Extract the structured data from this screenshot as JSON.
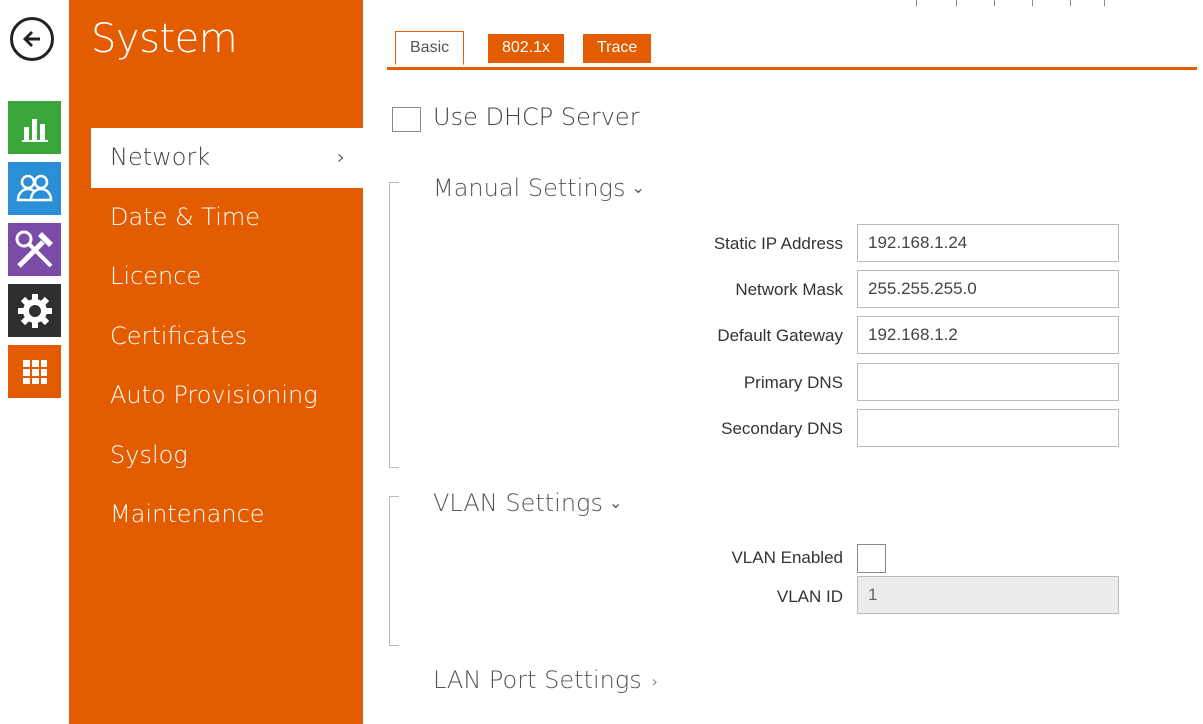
{
  "sidebar": {
    "title": "System",
    "items": [
      {
        "label": "Network",
        "active": true
      },
      {
        "label": "Date & Time"
      },
      {
        "label": "Licence"
      },
      {
        "label": "Certificates"
      },
      {
        "label": "Auto Provisioning"
      },
      {
        "label": "Syslog"
      },
      {
        "label": "Maintenance"
      }
    ],
    "active_chevron": "›"
  },
  "rail": {
    "icons": [
      "back-arrow-icon",
      "status-chart-icon",
      "directory-users-icon",
      "hardware-tools-icon",
      "system-gear-icon",
      "services-grid-icon"
    ],
    "colors": {
      "status": "#3aa53a",
      "directory": "#2a8fd6",
      "hardware": "#7b4ba8",
      "system": "#2f2f2f",
      "services": "#e25b00"
    }
  },
  "tabs": [
    {
      "label": "Basic",
      "active": true
    },
    {
      "label": "802.1x"
    },
    {
      "label": "Trace"
    }
  ],
  "dhcp": {
    "label": "Use DHCP Server",
    "checked": false
  },
  "manual": {
    "title": "Manual Settings",
    "caret": "⌄",
    "static_ip_label": "Static IP Address",
    "static_ip_value": "192.168.1.24",
    "mask_label": "Network Mask",
    "mask_value": "255.255.255.0",
    "gateway_label": "Default Gateway",
    "gateway_value": "192.168.1.2",
    "dns1_label": "Primary DNS",
    "dns1_value": "",
    "dns2_label": "Secondary DNS",
    "dns2_value": ""
  },
  "vlan": {
    "title": "VLAN Settings",
    "caret": "⌄",
    "enabled_label": "VLAN Enabled",
    "enabled": false,
    "id_label": "VLAN ID",
    "id_value": "1"
  },
  "lan": {
    "title": "LAN Port Settings",
    "caret": "›"
  },
  "accent_color": "#e35c00"
}
